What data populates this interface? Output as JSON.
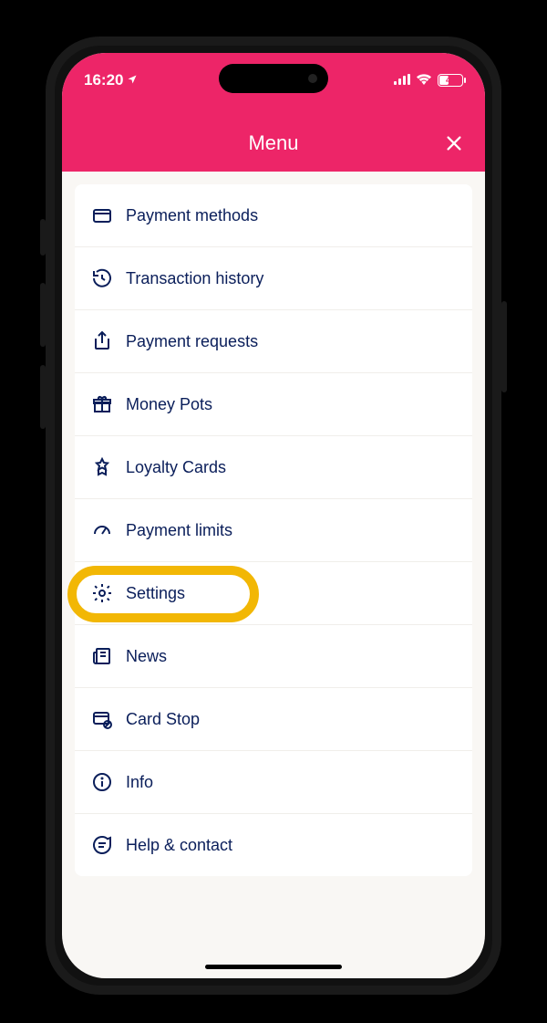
{
  "status": {
    "time": "16:20",
    "battery_percent": "41"
  },
  "header": {
    "title": "Menu"
  },
  "menu": {
    "items": [
      {
        "label": "Payment methods"
      },
      {
        "label": "Transaction history"
      },
      {
        "label": "Payment requests"
      },
      {
        "label": "Money Pots"
      },
      {
        "label": "Loyalty Cards"
      },
      {
        "label": "Payment limits"
      },
      {
        "label": "Settings"
      },
      {
        "label": "News"
      },
      {
        "label": "Card Stop"
      },
      {
        "label": "Info"
      },
      {
        "label": "Help & contact"
      }
    ],
    "highlighted_index": 6
  }
}
